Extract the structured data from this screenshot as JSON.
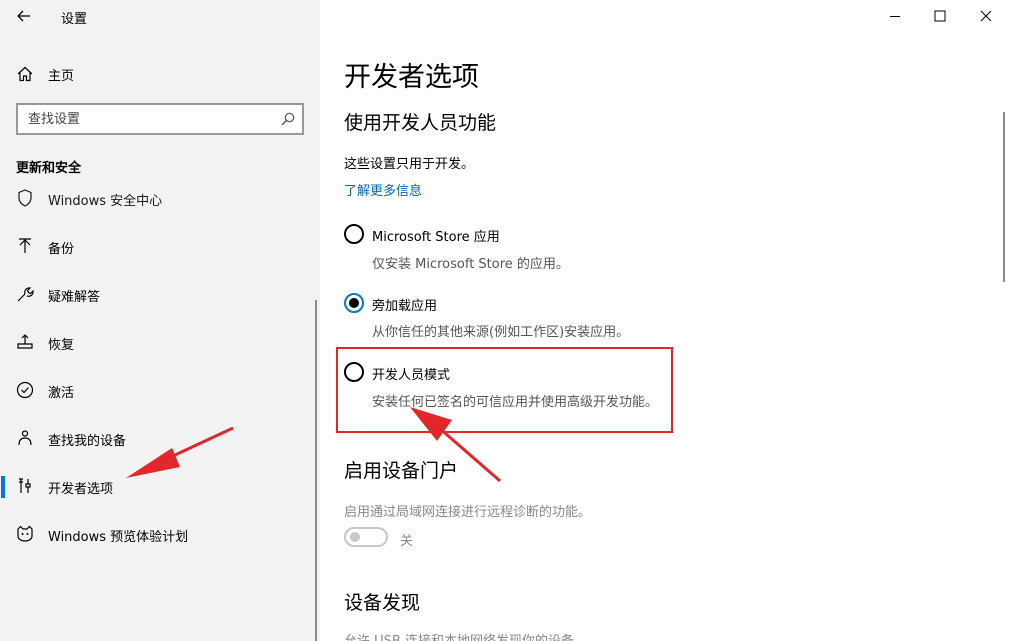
{
  "window": {
    "title": "设置"
  },
  "sidebar": {
    "home_label": "主页",
    "search_placeholder": "查找设置",
    "section_title": "更新和安全",
    "items": [
      {
        "label": "Windows 安全中心",
        "icon": "shield-icon"
      },
      {
        "label": "备份",
        "icon": "backup-arrow-icon"
      },
      {
        "label": "疑难解答",
        "icon": "wrench-icon"
      },
      {
        "label": "恢复",
        "icon": "recovery-icon"
      },
      {
        "label": "激活",
        "icon": "check-circle-icon"
      },
      {
        "label": "查找我的设备",
        "icon": "person-locate-icon"
      },
      {
        "label": "开发者选项",
        "icon": "developer-tools-icon",
        "selected": true
      },
      {
        "label": "Windows 预览体验计划",
        "icon": "insider-cat-icon"
      }
    ]
  },
  "main": {
    "title": "开发者选项",
    "section1": {
      "heading": "使用开发人员功能",
      "description": "这些设置只用于开发。",
      "link": "了解更多信息",
      "options": [
        {
          "label": "Microsoft Store 应用",
          "sub": "仅安装 Microsoft Store 的应用。",
          "checked": false
        },
        {
          "label": "旁加载应用",
          "sub": "从你信任的其他来源(例如工作区)安装应用。",
          "checked": true
        },
        {
          "label": "开发人员模式",
          "sub": "安装任何已签名的可信应用并使用高级开发功能。",
          "checked": false
        }
      ]
    },
    "section2": {
      "heading": "启用设备门户",
      "description": "启用通过局域网连接进行远程诊断的功能。",
      "toggle_label": "关",
      "toggle_on": false
    },
    "section3": {
      "heading": "设备发现",
      "description": "允许 USB 连接和本地网络发现你的设备。"
    }
  },
  "colors": {
    "accent": "#0078d7",
    "link": "#0067c0",
    "annotation": "#e3262a",
    "sidebar_bg": "#f2f2f2"
  }
}
